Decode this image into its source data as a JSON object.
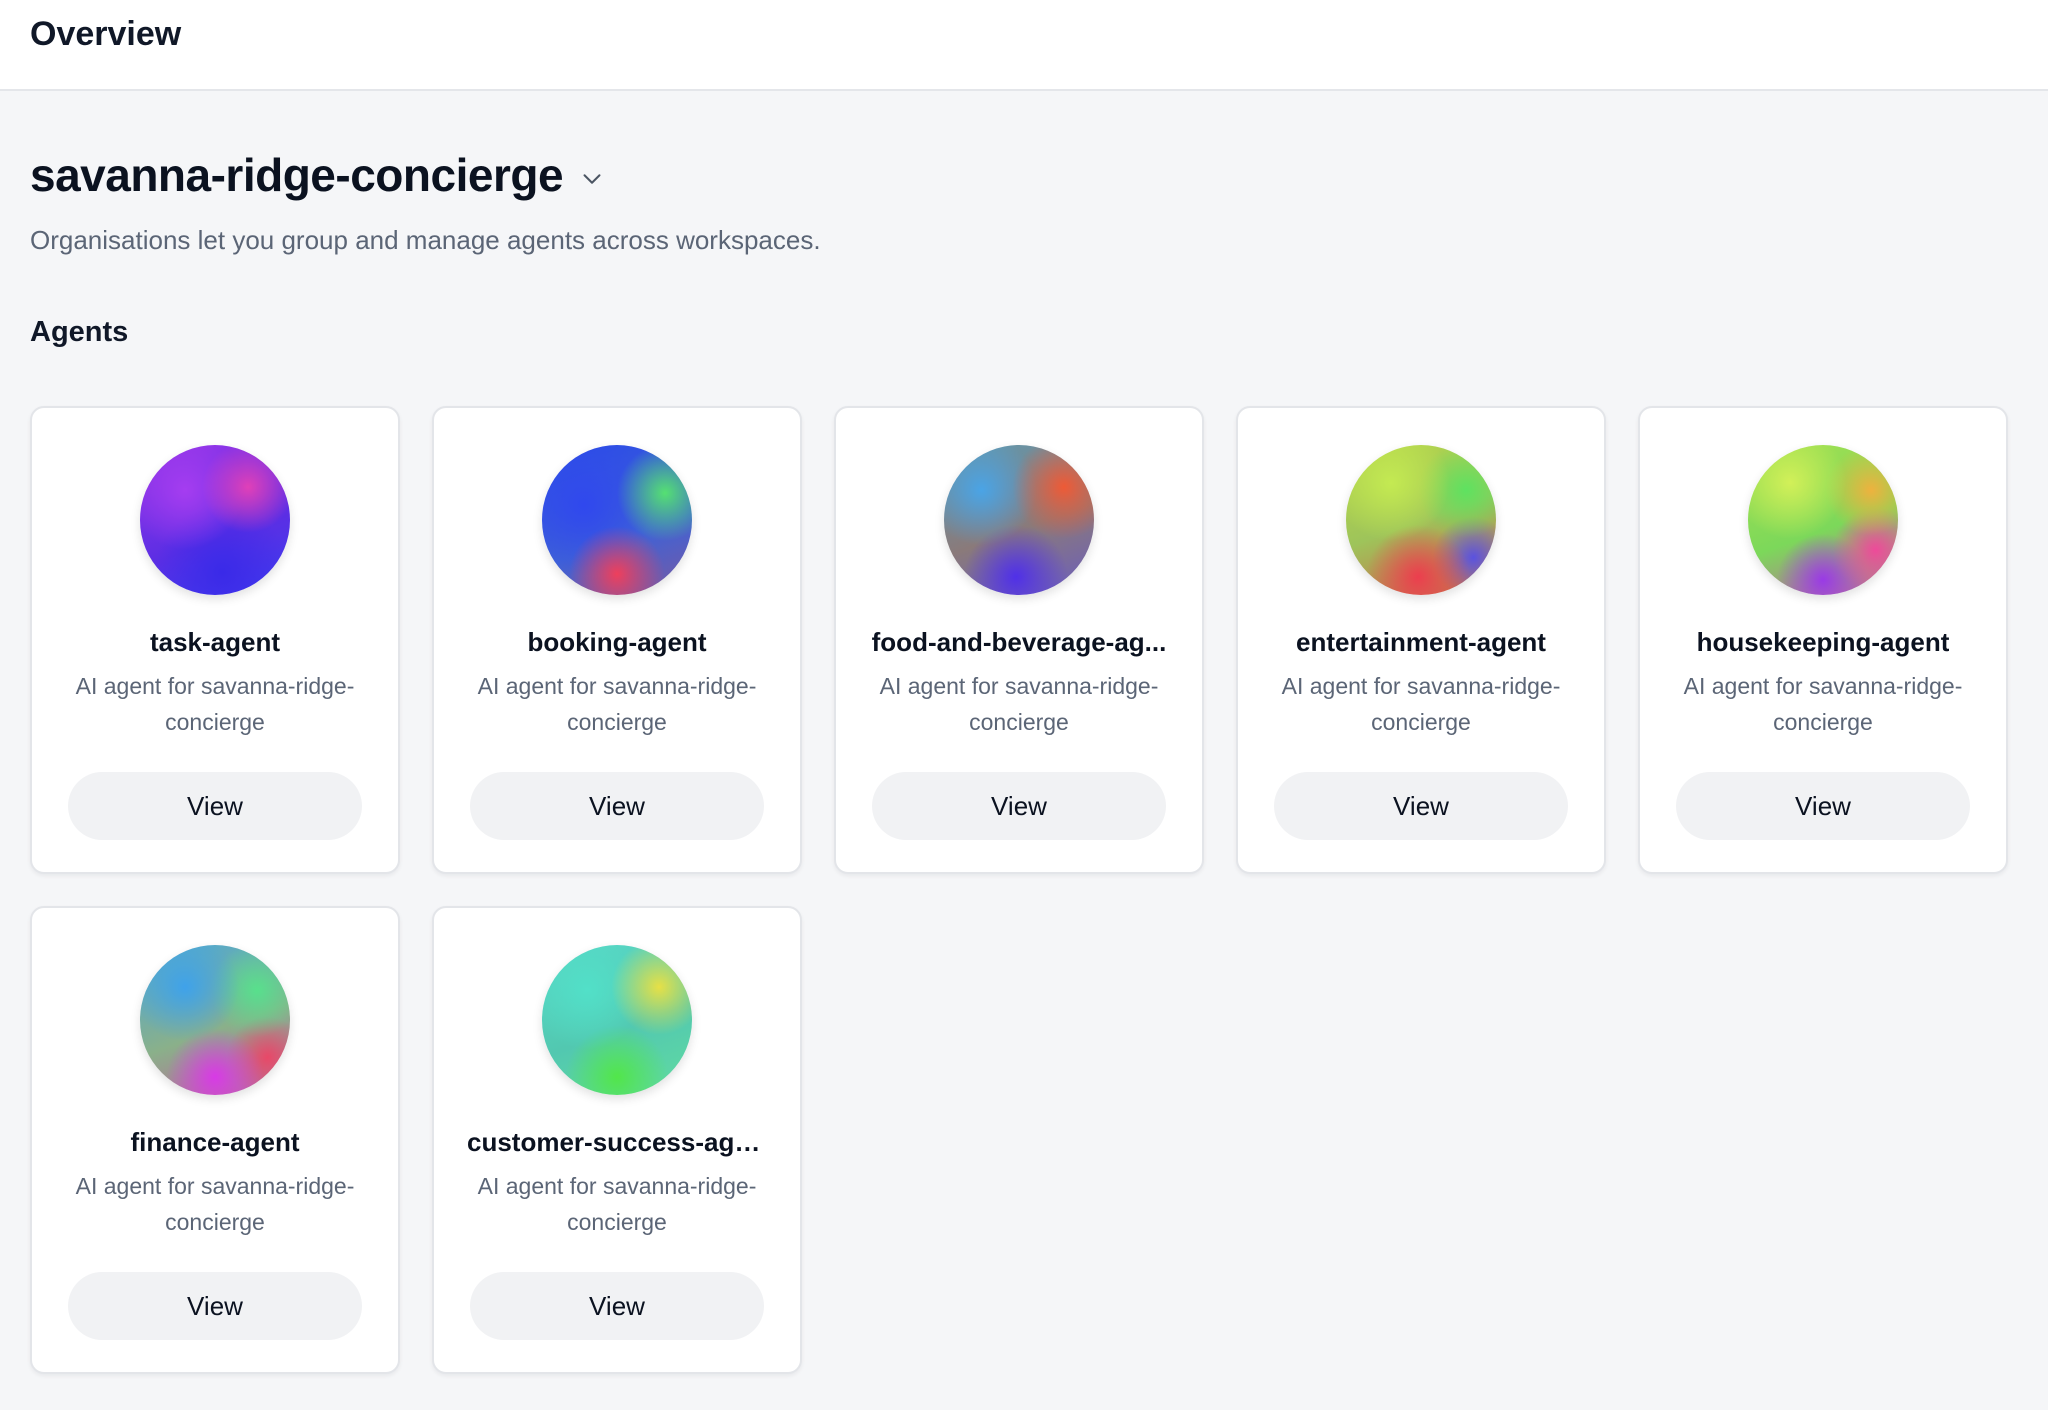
{
  "topbar": {
    "title": "Overview"
  },
  "org": {
    "name": "savanna-ridge-concierge",
    "description": "Organisations let you group and manage agents across workspaces."
  },
  "agents_section": {
    "title": "Agents"
  },
  "agents": [
    {
      "name": "task-agent",
      "description": "AI agent for savanna-ridge-concierge",
      "button": "View"
    },
    {
      "name": "booking-agent",
      "description": "AI agent for savanna-ridge-concierge",
      "button": "View"
    },
    {
      "name": "food-and-beverage-ag...",
      "description": "AI agent for savanna-ridge-concierge",
      "button": "View"
    },
    {
      "name": "entertainment-agent",
      "description": "AI agent for savanna-ridge-concierge",
      "button": "View"
    },
    {
      "name": "housekeeping-agent",
      "description": "AI agent for savanna-ridge-concierge",
      "button": "View"
    },
    {
      "name": "finance-agent",
      "description": "AI agent for savanna-ridge-concierge",
      "button": "View"
    },
    {
      "name": "customer-success-age...",
      "description": "AI agent for savanna-ridge-concierge",
      "button": "View"
    }
  ],
  "icons": {
    "org_dropdown": "chevron-down-icon"
  }
}
